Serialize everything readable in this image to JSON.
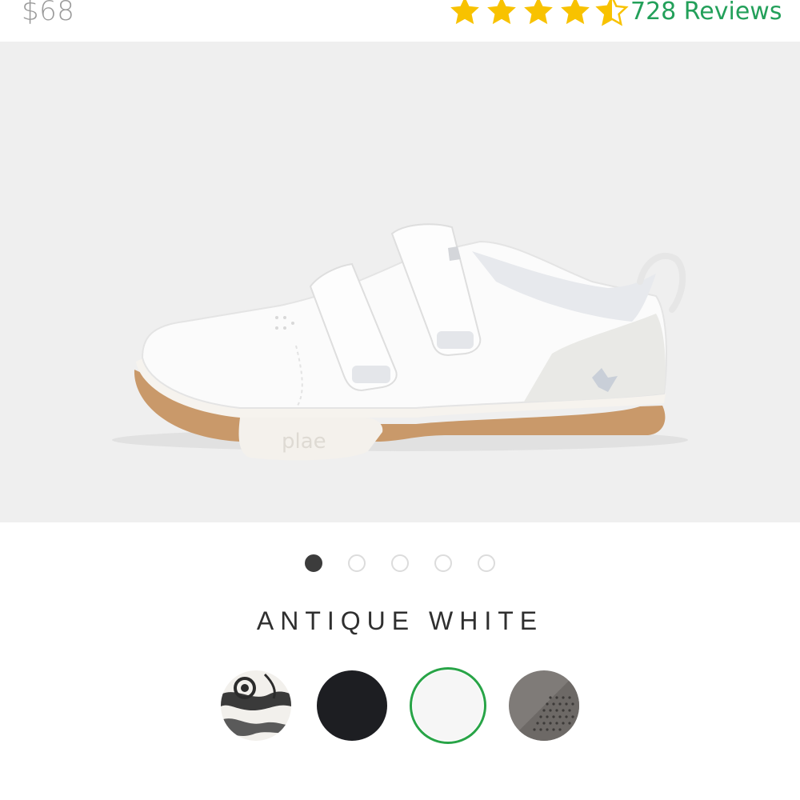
{
  "product": {
    "price": "$68",
    "rating_value": 4.5,
    "rating_max": 5,
    "reviews_label": "728 Reviews"
  },
  "gallery": {
    "image_count": 5,
    "active_index": 0,
    "brand_mark": "plae"
  },
  "selected_color": "ANTIQUE WHITE",
  "colors": {
    "star": "#f8c200",
    "review_link": "#23a05a",
    "selected_ring": "#28a447",
    "active_dot": "#3c3c3c"
  },
  "swatches": [
    {
      "name": "pattern-swatch",
      "pattern": "black-white-swirl"
    },
    {
      "name": "black-swatch",
      "fill": "#1d1e22"
    },
    {
      "name": "antique-white-swatch",
      "fill": "#f6f6f6",
      "selected": true
    },
    {
      "name": "gray-perforated-swatch",
      "fill": "#7f7b78"
    }
  ]
}
